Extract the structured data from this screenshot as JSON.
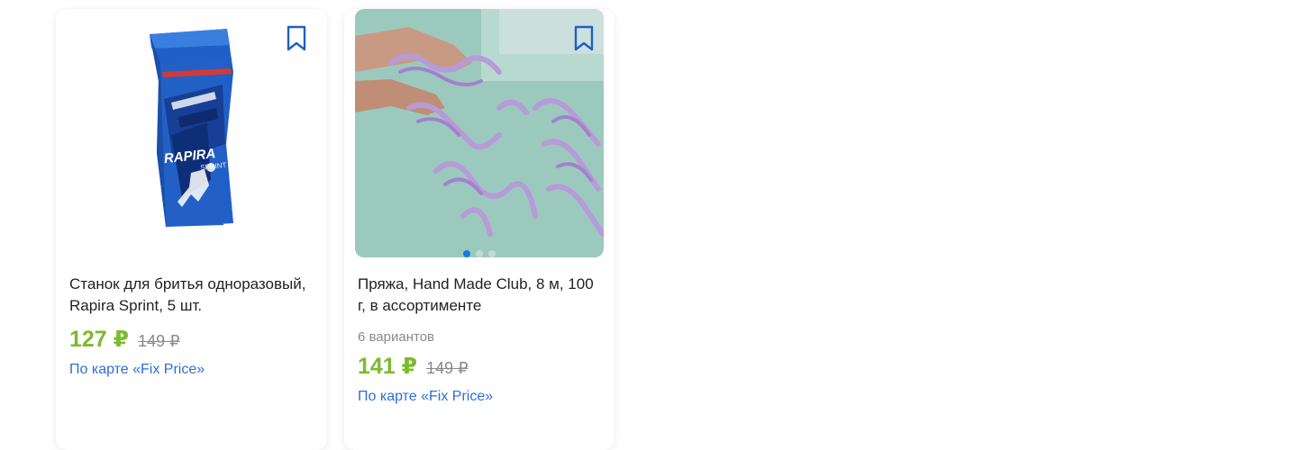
{
  "products": [
    {
      "title": "Станок для бритья одноразовый, Rapira Sprint, 5 шт.",
      "price": "127 ₽",
      "old_price": "149 ₽",
      "card_link": "По карте «Fix Price»",
      "bookmark_icon": "bookmark-icon"
    },
    {
      "title": "Пряжа, Hand Made Club, 8 м, 100 г, в ассортименте",
      "variants": "6 вариантов",
      "price": "141 ₽",
      "old_price": "149 ₽",
      "card_link": "По карте «Fix Price»",
      "bookmark_icon": "bookmark-icon"
    }
  ],
  "colors": {
    "price": "#7cbb2e",
    "link": "#2d6fd6",
    "bookmark": "#1f5fc4",
    "muted": "#8a8a8a"
  }
}
